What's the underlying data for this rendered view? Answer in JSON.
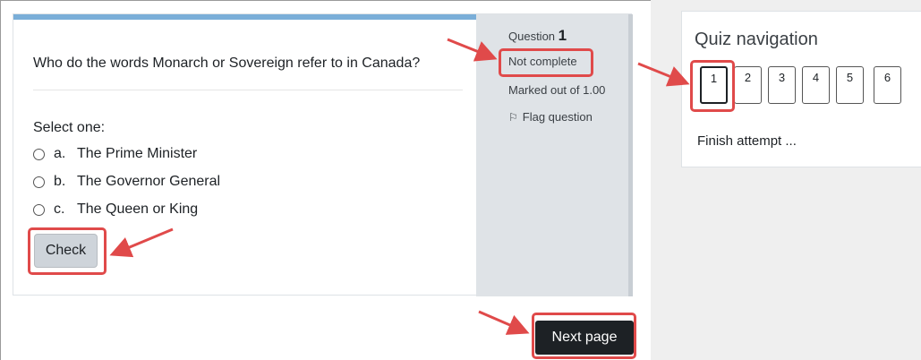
{
  "question": {
    "text": "Who do the words Monarch or Sovereign refer to in Canada?",
    "select_label": "Select one:",
    "options": [
      {
        "letter": "a.",
        "label": "The Prime Minister"
      },
      {
        "letter": "b.",
        "label": "The Governor General"
      },
      {
        "letter": "c.",
        "label": "The Queen or King"
      }
    ],
    "check_label": "Check"
  },
  "info": {
    "question_label": "Question",
    "question_number": "1",
    "state": "Not complete",
    "marked": "Marked out of 1.00",
    "flag_label": "Flag question"
  },
  "next_page_label": "Next page",
  "quiz_nav": {
    "title": "Quiz navigation",
    "buttons": [
      "1",
      "2",
      "3",
      "4",
      "5",
      "6"
    ],
    "current": "1",
    "finish_label": "Finish attempt ..."
  },
  "colors": {
    "highlight": "#e04a4a",
    "progress_strip": "#7aaed8",
    "info_bg": "#dfe3e7",
    "dark_button": "#1d2125"
  }
}
